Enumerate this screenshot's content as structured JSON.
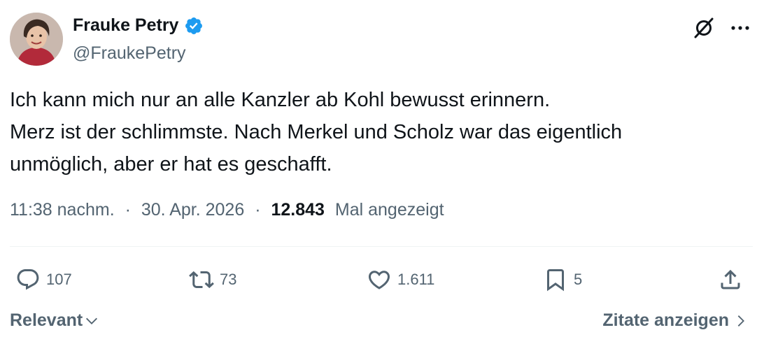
{
  "author": {
    "name": "Frauke Petry",
    "handle": "@FraukePetry",
    "verified": true
  },
  "icons": {
    "verified": "verified-badge-icon",
    "grok": "grok-icon",
    "more": "more-dots-icon",
    "reply": "reply-icon",
    "retweet": "retweet-icon",
    "like": "heart-icon",
    "bookmark": "bookmark-icon",
    "share": "share-icon",
    "chevron_down": "chevron-down-icon",
    "chevron_right": "chevron-right-icon"
  },
  "tweet": {
    "lines": [
      "Ich kann mich nur an alle Kanzler ab Kohl bewusst erinnern.",
      "Merz ist der schlimmste. Nach Merkel und Scholz war das eigentlich",
      "unmöglich, aber er hat es geschafft."
    ]
  },
  "meta": {
    "time": "11:38 nachm.",
    "separator": "·",
    "date": "30. Apr. 2026",
    "views_count": "12.843",
    "views_label": "Mal angezeigt"
  },
  "actions": {
    "replies": "107",
    "retweets": "73",
    "likes": "1.611",
    "bookmarks": "5"
  },
  "footer": {
    "sort_label": "Relevant",
    "quotes_link": "Zitate anzeigen"
  },
  "colors": {
    "text_primary": "#0f1419",
    "text_secondary": "#536471",
    "verified_blue": "#1d9bf0",
    "divider": "#eff3f4"
  }
}
